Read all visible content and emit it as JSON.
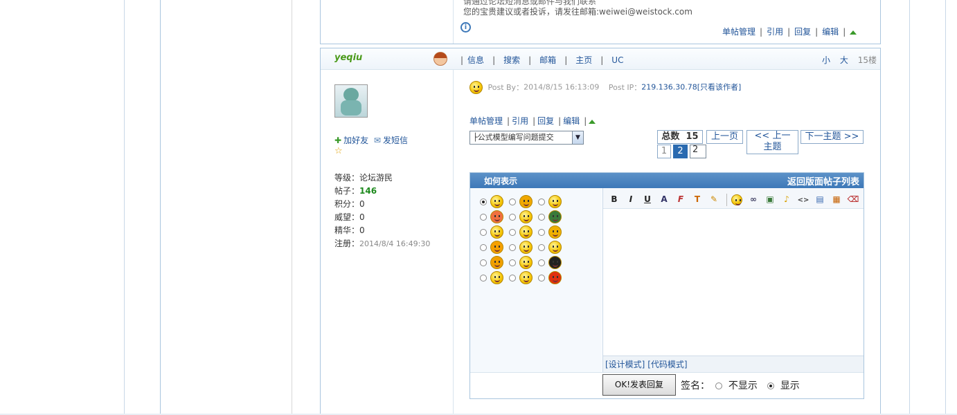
{
  "prev_post": {
    "partial_text": "请通过论坛短消息或邮件与我们联系",
    "contact_text": "您的宝贵建议或者投诉，请发往邮箱:weiwei@weistock.com",
    "actions": [
      "单帖管理",
      "引用",
      "回复",
      "编辑"
    ]
  },
  "post": {
    "username": "yeqiu",
    "top_links": [
      "信息",
      "搜索",
      "邮箱",
      "主页",
      "UC"
    ],
    "font_small": "小",
    "font_large": "大",
    "floor": "15楼",
    "add_friend": "加好友",
    "send_message": "发短信",
    "stats": [
      {
        "label": "等级：",
        "value": "论坛游民"
      },
      {
        "label": "帖子：",
        "value": "146"
      },
      {
        "label": "积分：",
        "value": "0"
      },
      {
        "label": "威望：",
        "value": "0"
      },
      {
        "label": "精华：",
        "value": "0"
      },
      {
        "label": "注册：",
        "value": "2014/8/4 16:49:30"
      }
    ],
    "post_by_label": "Post By：",
    "post_time": "2014/8/15 16:13:09",
    "post_ip_label": "Post IP：",
    "post_ip": "219.136.30.78",
    "only_author": "[只看该作者]",
    "actions": [
      "单帖管理",
      "引用",
      "回复",
      "编辑"
    ]
  },
  "nav": {
    "topic_select": "├公式模型编写问题提交",
    "total_label": "总数",
    "total_value": "15",
    "prev_page": "上一页",
    "prev_topic": "<< 上一主题",
    "next_topic": "下一主题 >>",
    "pages": [
      "1",
      "2"
    ],
    "page_input": "2"
  },
  "reply": {
    "title": "如何表示",
    "back_link": "返回版面帖子列表",
    "design_mode": "[设计模式]",
    "code_mode": "[代码模式]",
    "submit_label": "OK!发表回复",
    "signature_label": "签名：",
    "sig_hide": "不显示",
    "sig_show": "显示",
    "toolbar_icons": [
      "bold-icon",
      "italic-icon",
      "underline-icon",
      "font-size-icon",
      "font-family-icon",
      "text-color-icon",
      "highlight-icon",
      "emoticon-icon",
      "link-icon",
      "image-icon",
      "music-icon",
      "code-icon",
      "media-icon",
      "table-icon",
      "clear-format-icon"
    ]
  },
  "colors": {
    "accent": "#3d78b8",
    "border": "#a9c5de",
    "green": "#1e8a1e"
  }
}
